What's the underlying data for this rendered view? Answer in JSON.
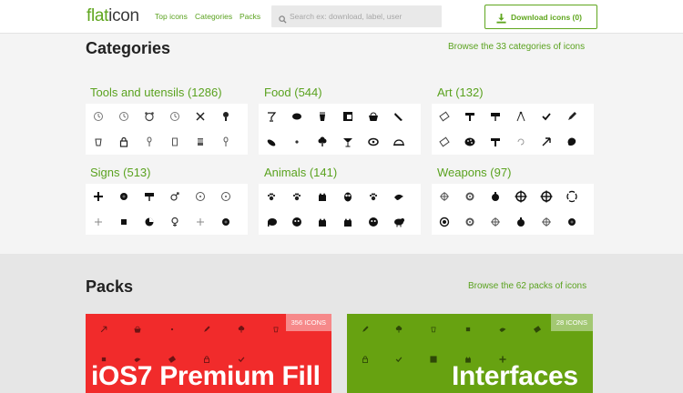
{
  "header": {
    "logo_part1": "flat",
    "logo_part2": "icon",
    "nav": [
      "Top icons",
      "Categories",
      "Packs"
    ],
    "search_placeholder": "Search ex: download, label, user",
    "download_label": "Download icons (0)"
  },
  "categories": {
    "title": "Categories",
    "browse_link": "Browse the 33 categories of icons",
    "items": [
      {
        "label": "Tools and utensils (1286)"
      },
      {
        "label": "Food (544)"
      },
      {
        "label": "Art (132)"
      },
      {
        "label": "Signs (513)"
      },
      {
        "label": "Animals (141)"
      },
      {
        "label": "Weapons (97)"
      }
    ]
  },
  "packs": {
    "title": "Packs",
    "browse_link": "Browse the 62 packs of icons",
    "items": [
      {
        "name": "iOS7 Premium Fill",
        "count": "356 ICONS",
        "color": "#f12b2b"
      },
      {
        "name": "Interfaces",
        "count": "28 ICONS",
        "color": "#67a211"
      }
    ]
  },
  "colors": {
    "accent": "#5fa61e",
    "pack_red": "#f12b2b",
    "pack_green": "#67a211"
  }
}
